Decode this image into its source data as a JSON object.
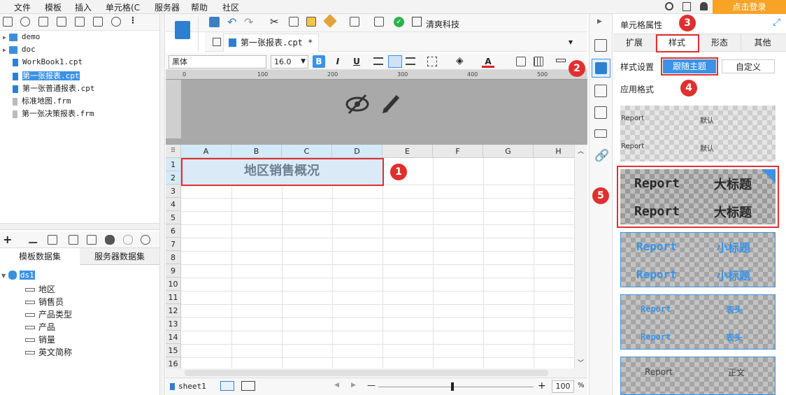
{
  "menu": {
    "items": [
      "文件",
      "模板",
      "插入",
      "单元格(C",
      "服务器",
      "帮助",
      "社区"
    ],
    "login_label": "点击登录"
  },
  "file_tree": {
    "items": [
      {
        "label": "demo",
        "type": "folder"
      },
      {
        "label": "doc",
        "type": "folder"
      },
      {
        "label": "WorkBook1.cpt",
        "type": "cpt"
      },
      {
        "label": "第一张报表.cpt",
        "type": "cpt",
        "selected": true
      },
      {
        "label": "第一张普通报表.cpt",
        "type": "cpt"
      },
      {
        "label": "标准地图.frm",
        "type": "frm"
      },
      {
        "label": "第一张决策报表.frm",
        "type": "frm"
      }
    ]
  },
  "dataset_tabs": [
    "模板数据集",
    "服务器数据集"
  ],
  "dataset_tree": {
    "root": "ds1",
    "fields": [
      "地区",
      "销售员",
      "产品类型",
      "产品",
      "销量",
      "英文简称"
    ]
  },
  "toolbar": {
    "company_label": "清爽科技"
  },
  "doc_tab": {
    "label": "第一张报表.cpt *"
  },
  "format_toolbar": {
    "font": "黑体",
    "font_size": "16.0",
    "bold_label": "B",
    "italic_label": "I",
    "underline_label": "U",
    "font_color_label": "A"
  },
  "ruler": {
    "ticks": [
      "0",
      "100",
      "200",
      "300",
      "400",
      "500"
    ]
  },
  "grid": {
    "columns": [
      "A",
      "B",
      "C",
      "D",
      "E",
      "F",
      "G",
      "H"
    ],
    "rows": [
      "1",
      "2",
      "3",
      "4",
      "5",
      "6",
      "7",
      "8",
      "9",
      "10",
      "11",
      "12",
      "13",
      "14",
      "15",
      "16"
    ],
    "merged_cell_text": "地区销售概况"
  },
  "bottom_bar": {
    "sheet_tab": "sheet1",
    "zoom_minus": "—",
    "zoom_plus": "+",
    "zoom_value": "100",
    "zoom_unit": "%"
  },
  "right_panel": {
    "title": "单元格属性",
    "tabs": [
      "扩展",
      "样式",
      "形态",
      "其他"
    ],
    "style_setting_label": "样式设置",
    "follow_theme_label": "跟随主题",
    "custom_label": "自定义",
    "apply_format_label": "应用格式",
    "thumbnails": [
      {
        "left": "Report",
        "right": "默认"
      },
      {
        "left": "Report",
        "right": "大标题"
      },
      {
        "left": "Report",
        "right": "小标题"
      },
      {
        "left": "Report",
        "right": "表头"
      },
      {
        "left": "Report",
        "right": "正文"
      }
    ]
  },
  "annotations": [
    "1",
    "2",
    "3",
    "4",
    "5"
  ],
  "colors": {
    "accent": "#3b92e6",
    "annotation_red": "#e02f2f",
    "login_orange": "#f7a325"
  }
}
